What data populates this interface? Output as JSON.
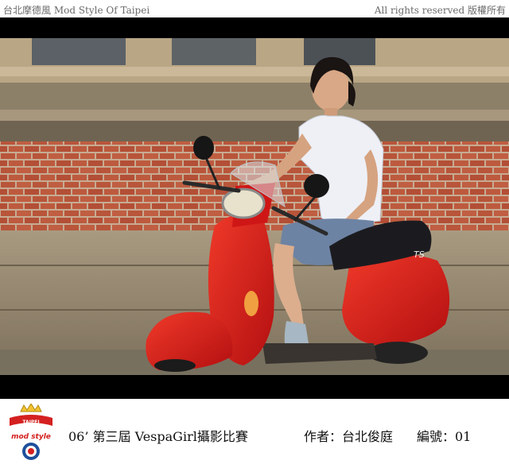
{
  "header": {
    "site_title": "台北摩德風 Mod Style Of Taipei",
    "copyright": "All rights reserved 版權所有"
  },
  "photo": {
    "scooter_badge": "TS"
  },
  "caption": {
    "title": "06’ 第三屆 VespaGirl攝影比賽",
    "author": "作者：台北俊庭",
    "number": "編號：01"
  },
  "logo": {
    "top_text": "TAIPEI",
    "bottom_text": "mod style"
  },
  "colors": {
    "scooter_red": "#d81818",
    "brick": "#b8553a",
    "stone": "#9a8c76",
    "logo_blue": "#1e4f9c",
    "logo_red": "#d42020"
  }
}
